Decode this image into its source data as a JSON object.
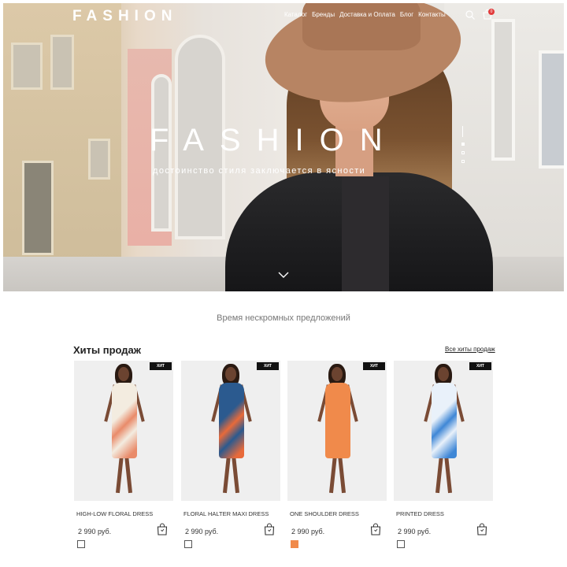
{
  "header": {
    "logo": "FASHION",
    "nav": [
      "Каталог",
      "Бренды",
      "Доставка и Оплата",
      "Блог",
      "Контакты"
    ],
    "cart_count": "0",
    "icons": [
      "search-icon",
      "cart-icon"
    ]
  },
  "hero": {
    "title": "FASHION",
    "subtitle": "достоинство стиля заключается в ясности",
    "slide_count": 3,
    "active_slide": 2
  },
  "tagline": "Время нескромных предложений",
  "bestsellers": {
    "title": "Хиты продаж",
    "all_link": "Все хиты продаж",
    "products": [
      {
        "badge": "ХИТ",
        "name": "HIGH-LOW FLORAL DRESS",
        "price": "2 990 руб.",
        "dress_color": "#f3ece0",
        "pattern_color": "#e98b6a",
        "swatch_color": "#ffffff"
      },
      {
        "badge": "ХИТ",
        "name": "FLORAL HALTER MAXI DRESS",
        "price": "2 990 руб.",
        "dress_color": "#2b5a8f",
        "pattern_color": "#e86a3a",
        "swatch_color": "#ffffff"
      },
      {
        "badge": "ХИТ",
        "name": "ONE SHOULDER DRESS",
        "price": "2 990 руб.",
        "dress_color": "#f08a4b",
        "pattern_color": "#f08a4b",
        "swatch_color": "#f08a4b"
      },
      {
        "badge": "ХИТ",
        "name": "PRINTED DRESS",
        "price": "2 990 руб.",
        "dress_color": "#e9f1fa",
        "pattern_color": "#3f87d6",
        "swatch_color": "#ffffff"
      }
    ]
  },
  "colors": {
    "badge_bg": "#111111",
    "cart_badge": "#e23b3b"
  }
}
